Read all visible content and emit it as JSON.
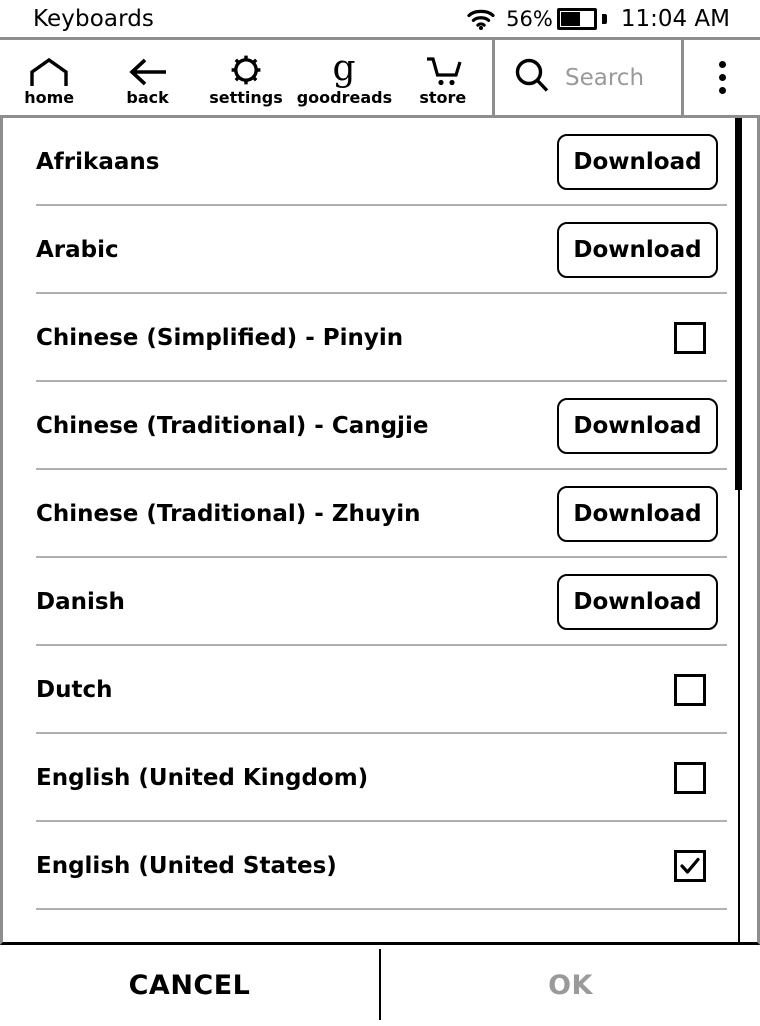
{
  "statusbar": {
    "title": "Keyboards",
    "wifi_icon": "wifi-icon",
    "battery_percent": "56%",
    "battery_level": 56,
    "time": "11:04 AM"
  },
  "toolbar": {
    "items": [
      {
        "label": "home",
        "icon": "home-icon"
      },
      {
        "label": "back",
        "icon": "back-arrow-icon"
      },
      {
        "label": "settings",
        "icon": "gear-icon"
      },
      {
        "label": "goodreads",
        "icon": "goodreads-g-icon"
      },
      {
        "label": "store",
        "icon": "shopping-cart-icon"
      }
    ],
    "search": {
      "icon": "search-icon",
      "placeholder": "Search",
      "value": ""
    },
    "overflow_icon": "overflow-menu-icon"
  },
  "list": {
    "download_label": "Download",
    "rows": [
      {
        "name": "Afrikaans",
        "control": "download"
      },
      {
        "name": "Arabic",
        "control": "download"
      },
      {
        "name": "Chinese (Simplified) - Pinyin",
        "control": "checkbox",
        "checked": false
      },
      {
        "name": "Chinese (Traditional) - Cangjie",
        "control": "download"
      },
      {
        "name": "Chinese (Traditional) - Zhuyin",
        "control": "download"
      },
      {
        "name": "Danish",
        "control": "download"
      },
      {
        "name": "Dutch",
        "control": "checkbox",
        "checked": false
      },
      {
        "name": "English (United Kingdom)",
        "control": "checkbox",
        "checked": false
      },
      {
        "name": "English (United States)",
        "control": "checkbox",
        "checked": true
      }
    ],
    "scrollbar": {
      "thumb_top": 0,
      "thumb_height": 372
    }
  },
  "footer": {
    "cancel_label": "CANCEL",
    "ok_label": "OK",
    "ok_enabled": false
  },
  "colors": {
    "text": "#000000",
    "muted": "#9a9a9a",
    "divider": "#b0b0b0",
    "border": "#8e8e8e",
    "background": "#ffffff"
  }
}
